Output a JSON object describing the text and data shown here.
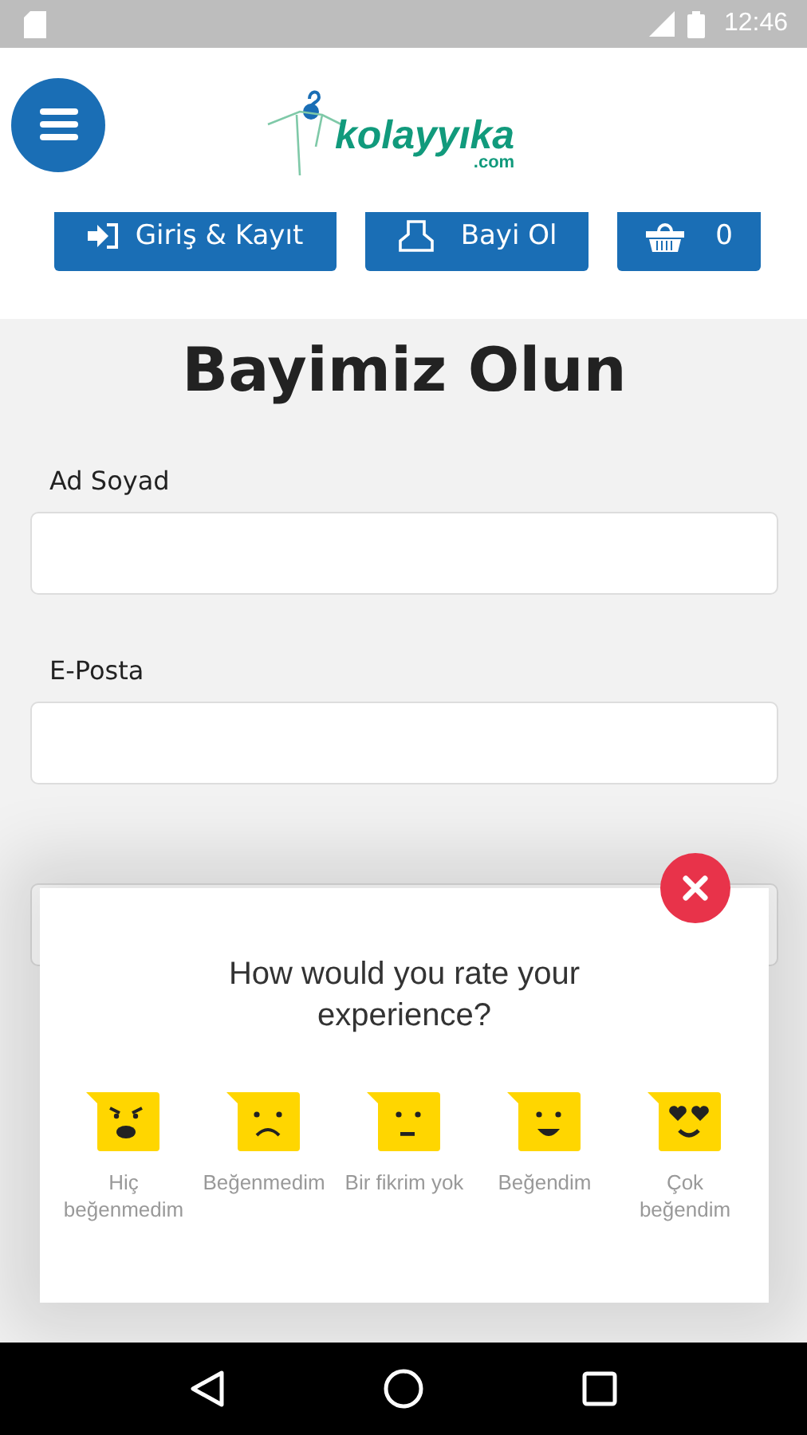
{
  "status_bar": {
    "time": "12:46"
  },
  "header": {
    "logo": {
      "name": "kolayyıka",
      "suffix": ".com"
    },
    "buttons": [
      {
        "kind": "login",
        "label": "Giriş & Kayıt"
      },
      {
        "kind": "dealer",
        "label": "Bayi Ol"
      },
      {
        "kind": "cart",
        "label": "0"
      }
    ]
  },
  "form": {
    "title": "Bayimiz Olun",
    "fields": [
      {
        "label": "Ad Soyad"
      },
      {
        "label": "E-Posta"
      }
    ]
  },
  "rating_dialog": {
    "question": "How would you rate your experience?",
    "options": [
      {
        "kind": "angry",
        "label": "Hiç beğenmedim"
      },
      {
        "kind": "sad",
        "label": "Beğenmedim"
      },
      {
        "kind": "neutral",
        "label": "Bir fikrim yok"
      },
      {
        "kind": "happy",
        "label": "Beğendim"
      },
      {
        "kind": "love",
        "label": "Çok beğendim"
      }
    ]
  }
}
